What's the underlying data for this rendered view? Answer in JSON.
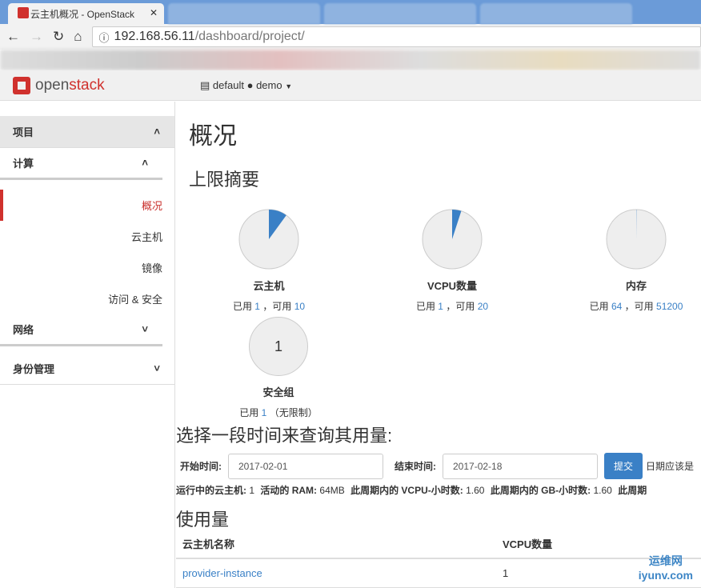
{
  "browser": {
    "tab_title": "云主机概况 - OpenStack",
    "url_host": "192.168.56.11",
    "url_path": "/dashboard/project/"
  },
  "header": {
    "logo_a": "open",
    "logo_b": "stack",
    "domain": "default",
    "project": "demo"
  },
  "sidebar": {
    "sections": [
      {
        "label": "项目"
      },
      {
        "label": "计算"
      },
      {
        "label": "网络"
      },
      {
        "label": "身份管理"
      }
    ],
    "items": [
      {
        "label": "概况"
      },
      {
        "label": "云主机"
      },
      {
        "label": "镜像"
      },
      {
        "label": "访问 & 安全"
      }
    ]
  },
  "main": {
    "title": "概况",
    "limits_title": "上限摘要",
    "pies": [
      {
        "label": "云主机",
        "used_label": "已用",
        "used": "1",
        "avail_label": "，可用",
        "avail": "10",
        "fraction": 0.1
      },
      {
        "label": "VCPU数量",
        "used_label": "已用",
        "used": "1",
        "avail_label": "，可用",
        "avail": "20",
        "fraction": 0.05
      },
      {
        "label": "内存",
        "used_label": "已用",
        "used": "64",
        "avail_label": "，可用",
        "avail": "51200",
        "fraction": 0.00125
      },
      {
        "label": "安全组",
        "center": "1",
        "used_label": "已用",
        "used": "1",
        "avail_label": "（无限制）",
        "avail": ""
      }
    ],
    "query_title": "选择一段时间来查询其用量:",
    "start_label": "开始时间:",
    "start_value": "2017-02-01",
    "end_label": "结束时间:",
    "end_value": "2017-02-18",
    "submit": "提交",
    "hint": "日期应该是",
    "stats": [
      {
        "label": "运行中的云主机:",
        "value": "1"
      },
      {
        "label": "活动的 RAM:",
        "value": "64MB"
      },
      {
        "label": "此周期内的 VCPU-小时数:",
        "value": "1.60"
      },
      {
        "label": "此周期内的 GB-小时数:",
        "value": "1.60"
      },
      {
        "label": "此周期",
        "value": ""
      }
    ],
    "usage_title": "使用量",
    "table": {
      "headers": [
        "云主机名称",
        "VCPU数量"
      ],
      "rows": [
        [
          "provider-instance",
          "1"
        ]
      ]
    }
  },
  "watermark": {
    "line1": "运维网",
    "line2": "iyunv.com"
  },
  "colors": {
    "accent": "#3a80c6",
    "brand": "#d0312d"
  }
}
